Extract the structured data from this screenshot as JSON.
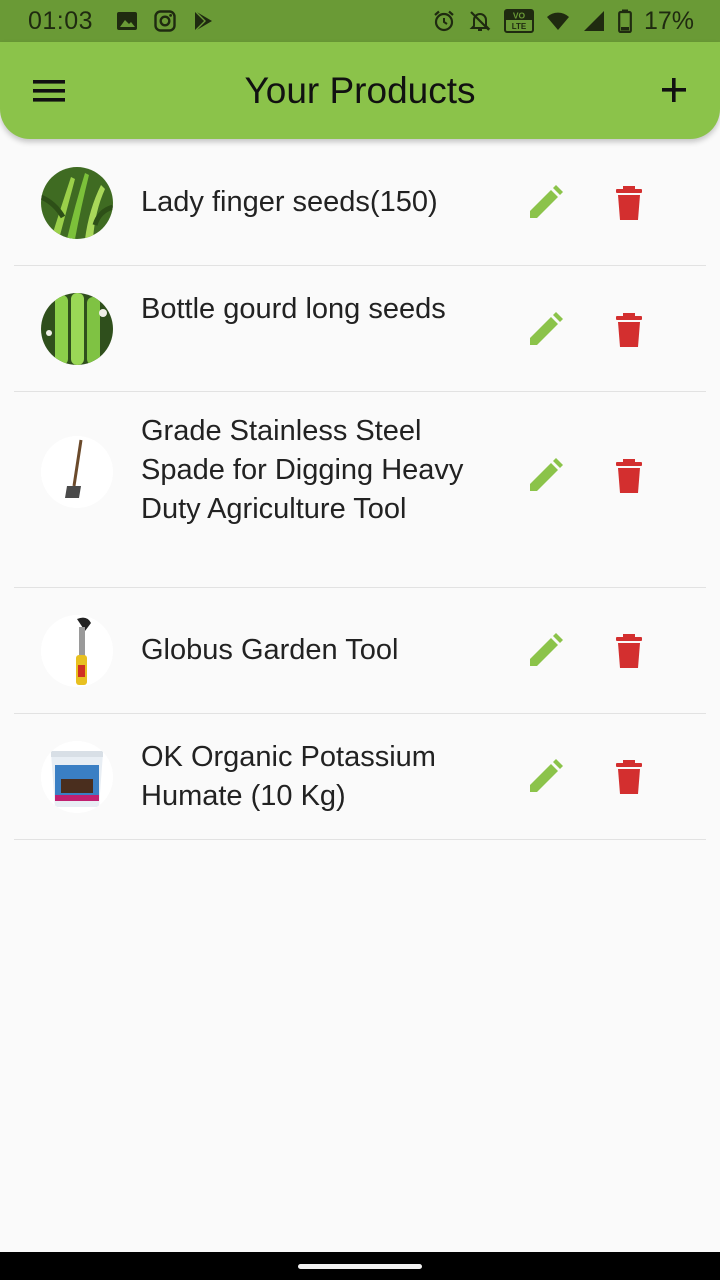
{
  "status_bar": {
    "time": "01:03",
    "battery": "17%",
    "left_icons": [
      "image-icon",
      "instagram-icon",
      "play-store-icon"
    ],
    "right_icons": [
      "alarm-icon",
      "notifications-off-icon",
      "volte-icon",
      "wifi-icon",
      "signal-icon",
      "battery-icon"
    ],
    "volte_label": "VO LTE"
  },
  "app_bar": {
    "title": "Your Products",
    "menu_icon": "menu-icon",
    "add_icon": "add-icon",
    "color": "#8bc34a"
  },
  "products": [
    {
      "name": "Lady finger seeds(150)",
      "image": "okra-image"
    },
    {
      "name": "Bottle gourd long seeds",
      "image": "bottle-gourd-image"
    },
    {
      "name": "Grade Stainless Steel Spade for Digging Heavy Duty Agriculture Tool",
      "image": "spade-image"
    },
    {
      "name": "Globus Garden Tool",
      "image": "garden-tool-image"
    },
    {
      "name": "OK Organic Potassium Humate (10 Kg)",
      "image": "humate-bucket-image"
    }
  ],
  "actions": {
    "edit_icon": "edit-icon",
    "delete_icon": "delete-icon",
    "edit_color": "#8bc34a",
    "delete_color": "#d32f2f"
  }
}
